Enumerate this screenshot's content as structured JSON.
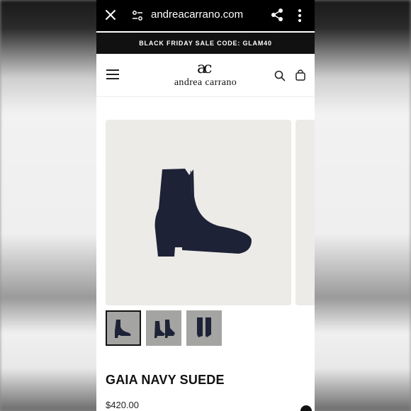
{
  "browser": {
    "url": "andreacarrano.com",
    "icons": [
      "close-icon",
      "site-settings-icon",
      "share-icon",
      "more-icon"
    ]
  },
  "promo": {
    "text": "BLACK FRIDAY SALE CODE: GLAM40"
  },
  "header": {
    "logo_mark": "ac",
    "logo_text": "andrea carrano",
    "icons": [
      "menu-icon",
      "search-icon",
      "bag-icon"
    ]
  },
  "product": {
    "title": "GAIA NAVY SUEDE",
    "price": "$420.00",
    "image_bg": "#ecebe8",
    "boot_color": "#1d2236",
    "thumbnails": [
      "thumb-1",
      "thumb-2",
      "thumb-3"
    ]
  }
}
